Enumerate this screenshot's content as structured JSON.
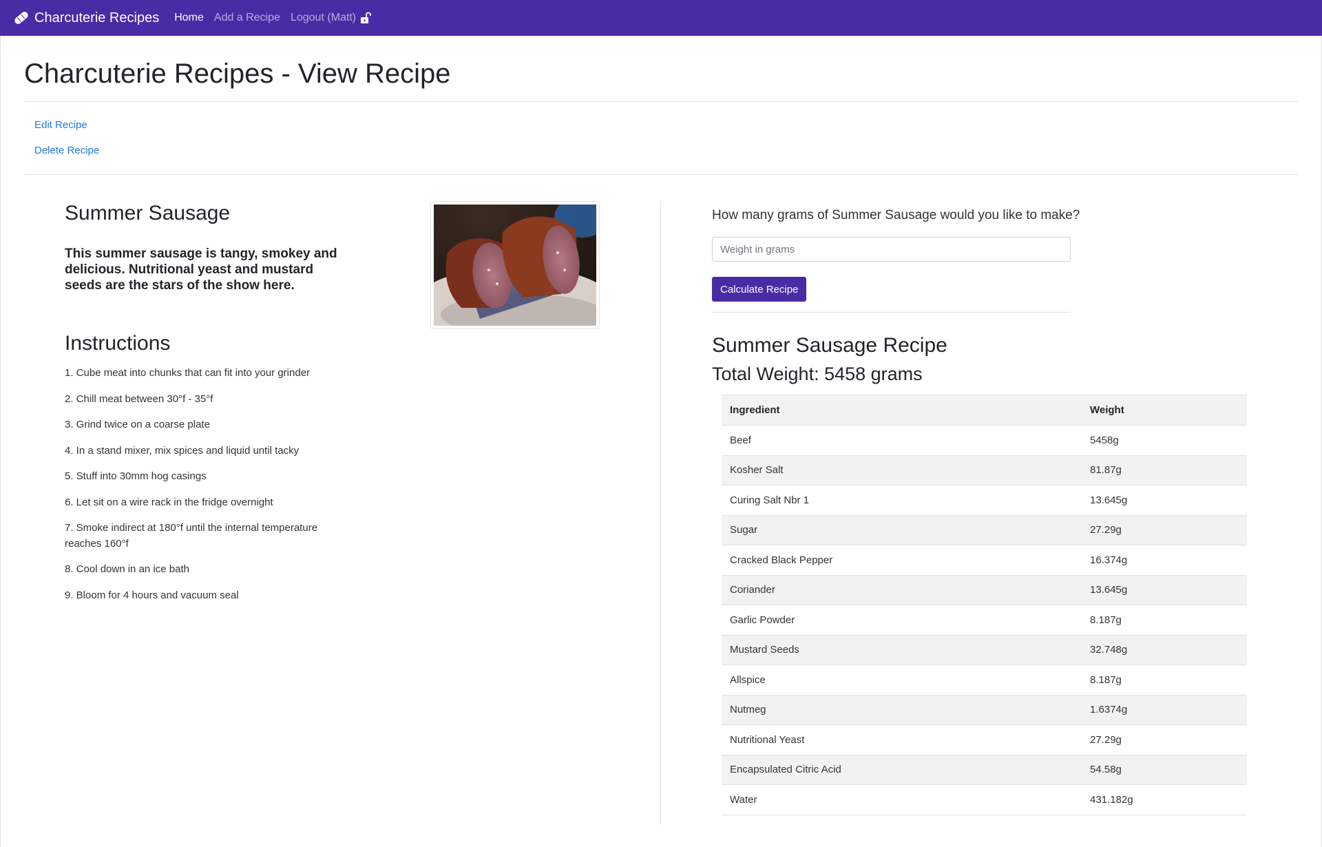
{
  "nav": {
    "brand": "Charcuterie Recipes",
    "links": [
      "Home",
      "Add a Recipe",
      "Logout (Matt)"
    ],
    "active": "Home",
    "brand_icon": "sausage-icon",
    "logout_icon": "unlock-icon",
    "color": "#4a2ba6"
  },
  "page": {
    "title": "Charcuterie Recipes - View Recipe",
    "actions": [
      "Edit Recipe",
      "Delete Recipe"
    ]
  },
  "recipe": {
    "name": "Summer Sausage",
    "description": "This summer sausage is tangy, smokey and delicious. Nutritional yeast and mustard seeds are the stars of the show here.",
    "instructions_title": "Instructions",
    "instructions": [
      "1. Cube meat into chunks that can fit into your grinder",
      "2. Chill meat between 30°f - 35°f",
      "3. Grind twice on a coarse plate",
      "4. In a stand mixer, mix spices and liquid until tacky",
      "5. Stuff into 30mm hog casings",
      "6. Let sit on a wire rack in the fridge overnight",
      "7. Smoke indirect at 180°f until the internal temperature reaches 160°f",
      "8. Cool down in an ice bath",
      "9. Bloom for 4 hours and vacuum seal"
    ]
  },
  "calculator": {
    "question": "How many grams of Summer Sausage would you like to make?",
    "input_placeholder": "Weight in grams",
    "input_value": "",
    "button": "Calculate Recipe",
    "result_title": "Summer Sausage Recipe",
    "total_weight": "Total Weight: 5458 grams",
    "table": {
      "headers": [
        "Ingredient",
        "Weight"
      ],
      "rows": [
        [
          "Beef",
          "5458g"
        ],
        [
          "Kosher Salt",
          "81.87g"
        ],
        [
          "Curing Salt Nbr 1",
          "13.645g"
        ],
        [
          "Sugar",
          "27.29g"
        ],
        [
          "Cracked Black Pepper",
          "16.374g"
        ],
        [
          "Coriander",
          "13.645g"
        ],
        [
          "Garlic Powder",
          "8.187g"
        ],
        [
          "Mustard Seeds",
          "32.748g"
        ],
        [
          "Allspice",
          "8.187g"
        ],
        [
          "Nutmeg",
          "1.6374g"
        ],
        [
          "Nutritional Yeast",
          "27.29g"
        ],
        [
          "Encapsulated Citric Acid",
          "54.58g"
        ],
        [
          "Water",
          "431.182g"
        ]
      ]
    }
  }
}
